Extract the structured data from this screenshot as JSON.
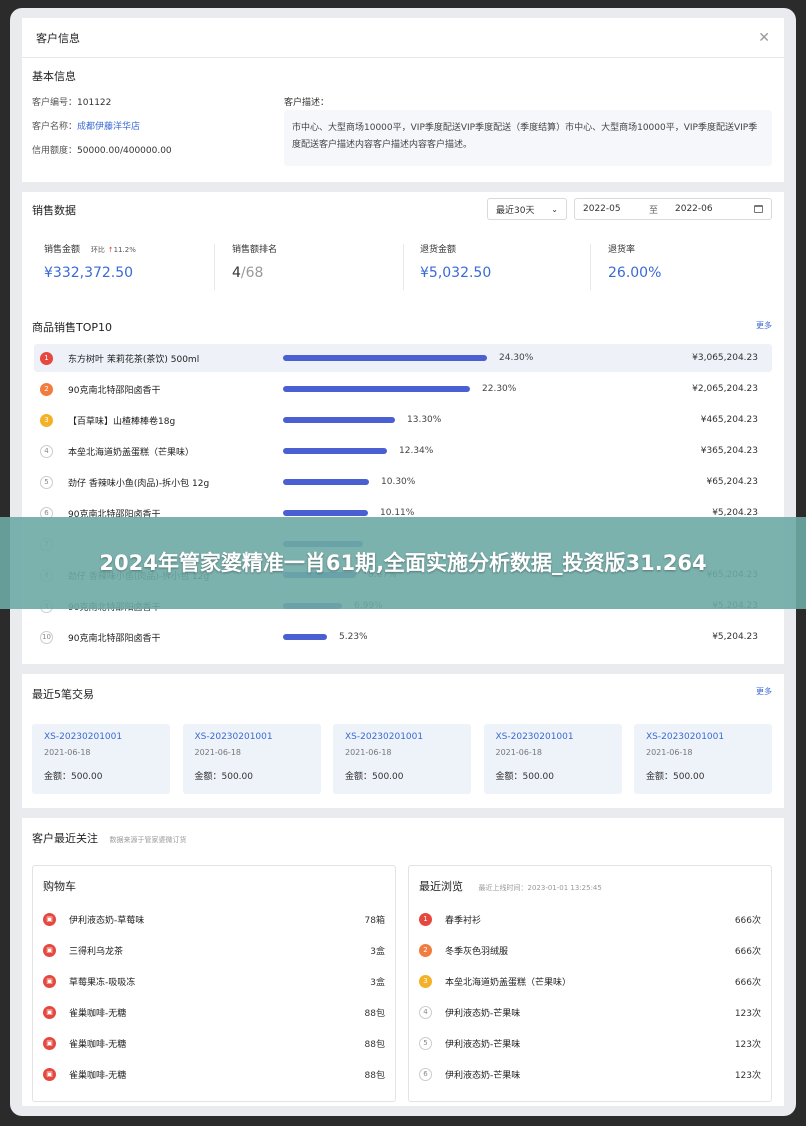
{
  "dialog": {
    "title": "客户信息"
  },
  "basic": {
    "section_title": "基本信息",
    "code_label": "客户编号：",
    "code_value": "101122",
    "name_label": "客户名称：",
    "name_value": "成都伊藤洋华店",
    "credit_label": "信用额度：",
    "credit_value": "50000.00/400000.00",
    "desc_label": "客户描述：",
    "desc_value": "市中心、大型商场10000平，VIP季度配送VIP季度配送（季度结算）市中心、大型商场10000平，VIP季度配送VIP季度配送客户描述内容客户描述内容客户描述。"
  },
  "sales": {
    "section_title": "销售数据",
    "range_select": "最近30天",
    "date_from": "2022-05",
    "date_sep": "至",
    "date_to": "2022-06",
    "kpis": [
      {
        "label": "销售金额",
        "compare_label": "环比",
        "compare_value": "11.2%",
        "value": "¥332,372.50"
      },
      {
        "label": "销售额排名",
        "rank": "4",
        "total": "/68"
      },
      {
        "label": "退货金额",
        "value": "¥5,032.50"
      },
      {
        "label": "退货率",
        "value": "26.00%"
      }
    ]
  },
  "top10": {
    "section_title": "商品销售TOP10",
    "more": "更多",
    "items": [
      {
        "rank": "1",
        "name": "东方树叶 茉莉花茶(茶饮) 500ml",
        "pct": "24.30%",
        "pct_value": 24.3,
        "amount": "¥3,065,204.23"
      },
      {
        "rank": "2",
        "name": "90克南北特邵阳卤香干",
        "pct": "22.30%",
        "pct_value": 22.3,
        "amount": "¥2,065,204.23"
      },
      {
        "rank": "3",
        "name": "【百草味】山楂棒棒卷18g",
        "pct": "13.30%",
        "pct_value": 13.3,
        "amount": "¥465,204.23"
      },
      {
        "rank": "4",
        "name": "本垒北海道奶盖蛋糕（芒果味）",
        "pct": "12.34%",
        "pct_value": 12.34,
        "amount": "¥365,204.23"
      },
      {
        "rank": "5",
        "name": "劲仔 香辣味小鱼(肉品)-拆小包 12g",
        "pct": "10.30%",
        "pct_value": 10.3,
        "amount": "¥65,204.23"
      },
      {
        "rank": "6",
        "name": "90克南北特邵阳卤香干",
        "pct": "10.11%",
        "pct_value": 10.11,
        "amount": "¥5,204.23"
      },
      {
        "rank": "7",
        "name": "",
        "pct": "",
        "pct_value": 9.5,
        "amount": ""
      },
      {
        "rank": "8",
        "name": "劲仔 香辣味小鱼(肉品)-拆小包 12g",
        "pct": "8.67%",
        "pct_value": 8.67,
        "amount": "¥65,204.23"
      },
      {
        "rank": "9",
        "name": "90克南北特邵阳卤香干",
        "pct": "6.99%",
        "pct_value": 6.99,
        "amount": "¥5,204.23"
      },
      {
        "rank": "10",
        "name": "90克南北特邵阳卤香干",
        "pct": "5.23%",
        "pct_value": 5.23,
        "amount": "¥5,204.23"
      }
    ]
  },
  "recent_tx": {
    "section_title": "最近5笔交易",
    "more": "更多",
    "items": [
      {
        "id": "XS-20230201001",
        "date": "2021-06-18",
        "amount": "金额：500.00"
      },
      {
        "id": "XS-20230201001",
        "date": "2021-06-18",
        "amount": "金额：500.00"
      },
      {
        "id": "XS-20230201001",
        "date": "2021-06-18",
        "amount": "金额：500.00"
      },
      {
        "id": "XS-20230201001",
        "date": "2021-06-18",
        "amount": "金额：500.00"
      },
      {
        "id": "XS-20230201001",
        "date": "2021-06-18",
        "amount": "金额：500.00"
      }
    ]
  },
  "attention": {
    "section_title": "客户最近关注",
    "source_note": "数据来源于管家婆微订货",
    "cart": {
      "title": "购物车",
      "items": [
        {
          "name": "伊利液态奶-草莓味",
          "qty": "78箱"
        },
        {
          "name": "三得利乌龙茶",
          "qty": "3盒"
        },
        {
          "name": "草莓果冻-吸吸冻",
          "qty": "3盒"
        },
        {
          "name": "雀巢咖啡-无糖",
          "qty": "88包"
        },
        {
          "name": "雀巢咖啡-无糖",
          "qty": "88包"
        },
        {
          "name": "雀巢咖啡-无糖",
          "qty": "88包"
        }
      ]
    },
    "browse": {
      "title": "最近浏览",
      "last_online": "最近上线时间：2023-01-01 13:25:45",
      "items": [
        {
          "rank": "1",
          "name": "春季衬衫",
          "views": "666次"
        },
        {
          "rank": "2",
          "name": "冬季灰色羽绒服",
          "views": "666次"
        },
        {
          "rank": "3",
          "name": "本垒北海道奶盖蛋糕（芒果味）",
          "views": "666次"
        },
        {
          "rank": "4",
          "name": "伊利液态奶-芒果味",
          "views": "123次"
        },
        {
          "rank": "5",
          "name": "伊利液态奶-芒果味",
          "views": "123次"
        },
        {
          "rank": "6",
          "name": "伊利液态奶-芒果味",
          "views": "123次"
        }
      ]
    }
  },
  "banner": {
    "text": "2024年管家婆精准一肖61期,全面实施分析数据_投资版31.264"
  },
  "colors": {
    "accent": "#3a6ad6",
    "bar": "#4a5fd1",
    "rank1": "#e5483f",
    "rank2": "#f07c3d",
    "rank3": "#f4b126",
    "cart_icon": "#e5483f"
  }
}
